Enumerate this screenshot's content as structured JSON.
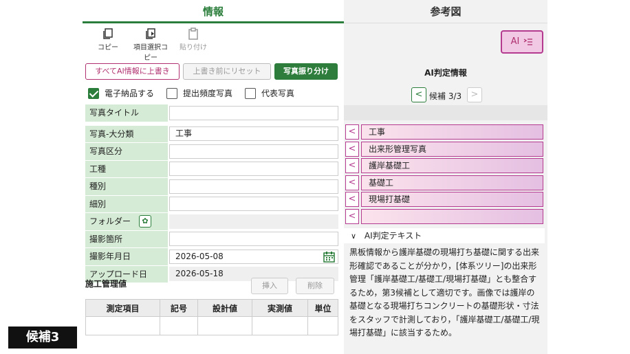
{
  "tabs": {
    "info": "情報",
    "reference": "参考図"
  },
  "toolbar": {
    "copy": "コピー",
    "select_copy": "項目選択コピー",
    "paste": "貼り付け"
  },
  "actions": {
    "overwrite_all": "すべてAI情報に上書き",
    "reset": "上書き前にリセット",
    "sort_photo": "写真振り分け"
  },
  "checks": [
    {
      "label": "電子納品する",
      "checked": true
    },
    {
      "label": "提出頻度写真",
      "checked": false
    },
    {
      "label": "代表写真",
      "checked": false
    }
  ],
  "form": {
    "photo_title": {
      "label": "写真タイトル",
      "value": ""
    },
    "category_major": {
      "label": "写真-大分類",
      "value": "工事"
    },
    "photo_section": {
      "label": "写真区分",
      "value": ""
    },
    "work_type": {
      "label": "工種",
      "value": ""
    },
    "type": {
      "label": "種別",
      "value": ""
    },
    "detail": {
      "label": "細別",
      "value": ""
    },
    "folder": {
      "label": "フォルダー",
      "value": ""
    },
    "location": {
      "label": "撮影箇所",
      "value": ""
    },
    "shot_date": {
      "label": "撮影年月日",
      "value": "2026-05-08"
    },
    "upload_date": {
      "label": "アップロード日",
      "value": "2026-05-18"
    }
  },
  "construction": {
    "title": "施工管理値",
    "insert": "挿入",
    "delete": "削除",
    "columns": [
      "測定項目",
      "記号",
      "設計値",
      "実測値",
      "単位"
    ]
  },
  "ai": {
    "button": "AI",
    "title": "AI判定情報",
    "counter": "候補 3/3",
    "items": [
      "工事",
      "出来形管理写真",
      "護岸基礎工",
      "基礎工",
      "現場打基礎",
      ""
    ],
    "text_header": "AI判定テキスト",
    "text_body": "黒板情報から護岸基礎の現場打ち基礎に関する出来形確認であることが分かり，[体系ツリー]の出来形管理「護岸基礎工/基礎工/現場打基礎」とも整合するため，第3候補として適切です。画像では護岸の基礎となる現場打ちコンクリートの基礎形状・寸法をスタッフで計測しており，「護岸基礎工/基礎工/現場打基礎」に該当するため。"
  },
  "badge": "候補3",
  "colors": {
    "accent_green": "#2a7d3a",
    "ai_magenta": "#b43a8f",
    "label_bg": "#d5ebd5"
  }
}
